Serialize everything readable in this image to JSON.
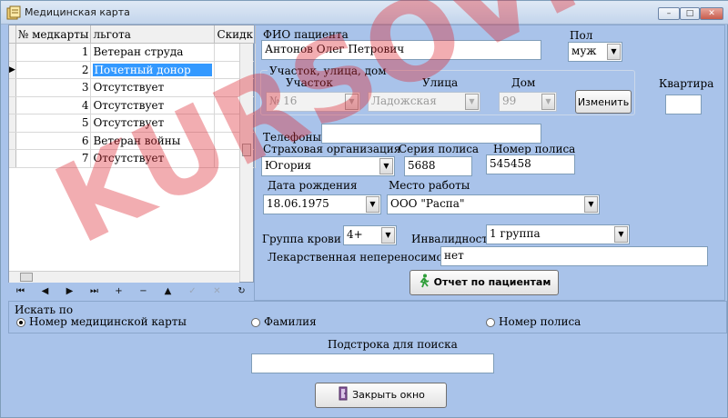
{
  "window": {
    "title": "Медицинская карта",
    "controls": {
      "min": "–",
      "max": "□",
      "close": "✕"
    }
  },
  "grid": {
    "columns": [
      "№ медкарты",
      "льгота",
      "Скидк"
    ],
    "rows": [
      {
        "num": "1",
        "benefit": "Ветеран струда"
      },
      {
        "num": "2",
        "benefit": "Почетный донор"
      },
      {
        "num": "3",
        "benefit": "Отсутствует"
      },
      {
        "num": "4",
        "benefit": "Отсутствует"
      },
      {
        "num": "5",
        "benefit": "Отсутствует"
      },
      {
        "num": "6",
        "benefit": "Ветеран войны"
      },
      {
        "num": "7",
        "benefit": "Отсутствует"
      }
    ],
    "selected_row": 2,
    "row_indicator": "▶"
  },
  "navigator": {
    "buttons": [
      "⏮",
      "◀",
      "▶",
      "⏭",
      "+",
      "−",
      "▲",
      "✓",
      "✕",
      "↻"
    ]
  },
  "form": {
    "fio_label": "ФИО пациента",
    "fio_value": "Антонов Олег Петрович",
    "sex_label": "Пол",
    "sex_value": "муж",
    "address_group": "Участок, улица, дом",
    "district_label": "Участок",
    "district_value": "№ 16",
    "street_label": "Улица",
    "street_value": "Ладожская",
    "house_label": "Дом",
    "house_value": "99",
    "change_button": "Изменить",
    "apartment_label": "Квартира",
    "apartment_value": "",
    "phones_label": "Телефоны",
    "phones_value": "",
    "insurance_label": "Страховая организация",
    "insurance_value": "Югория",
    "policy_series_label": "Серия полиса",
    "policy_series_value": "5688",
    "policy_number_label": "Номер полиса",
    "policy_number_value": "545458",
    "birth_label": "Дата рождения",
    "birth_value": "18.06.1975",
    "work_label": "Место работы",
    "work_value": "ООО \"Распа\"",
    "blood_label": "Группа крови",
    "blood_value": "4+",
    "disability_label": "Инвалидность",
    "disability_value": "1 группа",
    "allergy_label": "Лекарственная непереносимость",
    "allergy_value": "нет",
    "report_button": "Отчет по пациентам"
  },
  "search": {
    "group_label": "Искать по",
    "options": [
      "Номер медицинской карты",
      "Фамилия",
      "Номер полиса"
    ],
    "selected": 0,
    "substring_label": "Подстрока для поиска",
    "substring_value": ""
  },
  "close_button": "Закрыть окно",
  "watermark": "KURSOVIK.COM",
  "colors": {
    "background": "#a9c3ea",
    "selection": "#3399ff",
    "watermark": "#dc2832"
  }
}
